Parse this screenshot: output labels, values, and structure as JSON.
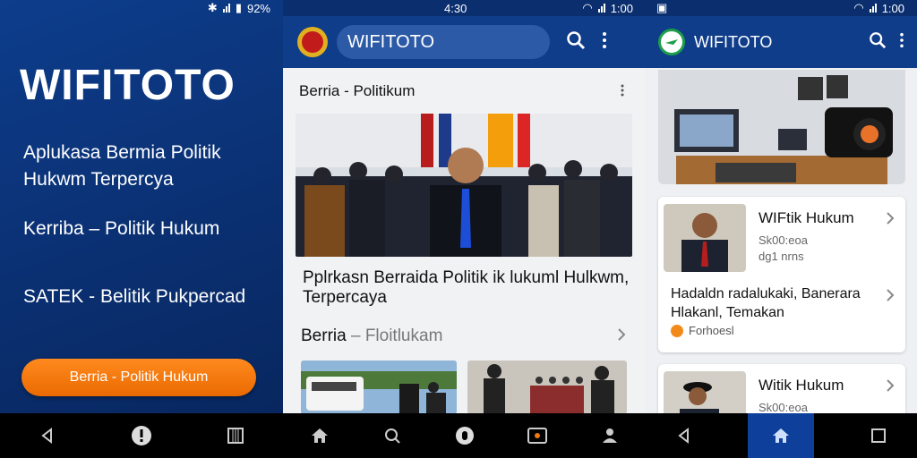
{
  "colors": {
    "brand_blue": "#0f3d8a",
    "cta_orange": "#f07a10",
    "nav_black": "#000000"
  },
  "screen1": {
    "status": "92%",
    "brand": "WIFITOTO",
    "tagline": "Aplukasa Bermia Politik Hukwm Terpercya",
    "line2": "Kerriba – Politik Hukum",
    "line3": "SATEK - Belitik Pukpercad",
    "cta": "Berria - Politik Hukum",
    "nav_icons": [
      "back-icon",
      "alert-icon",
      "grid-icon"
    ]
  },
  "screen2": {
    "status_left": "4:30",
    "status_right": "1:00",
    "search_text": "WIFITOTO",
    "section1": "Berria - Politikum",
    "headline": "Pplrkasn Berraida Politik ik lukuml Hulkwm, Terpercaya",
    "section2_main": "Berria",
    "section2_sub": "– Floitlukam",
    "nav_icons": [
      "home-icon",
      "search-icon",
      "shield-icon",
      "tv-icon",
      "person-icon"
    ]
  },
  "screen3": {
    "status_right": "1:00",
    "title": "WIFITOTO",
    "card1": {
      "title": "WIFtik Hukum",
      "meta1": "Sk00:eoa",
      "meta2": "dg1 nrns",
      "body": "Hadaldn radalukaki, Banerara Hlakanl, Temakan",
      "tag": "Forhoesl"
    },
    "card2": {
      "title": "Witik Hukum",
      "meta1": "Sk00:eoa"
    },
    "nav_icons": [
      "back-icon",
      "home-icon",
      "square-icon"
    ]
  }
}
